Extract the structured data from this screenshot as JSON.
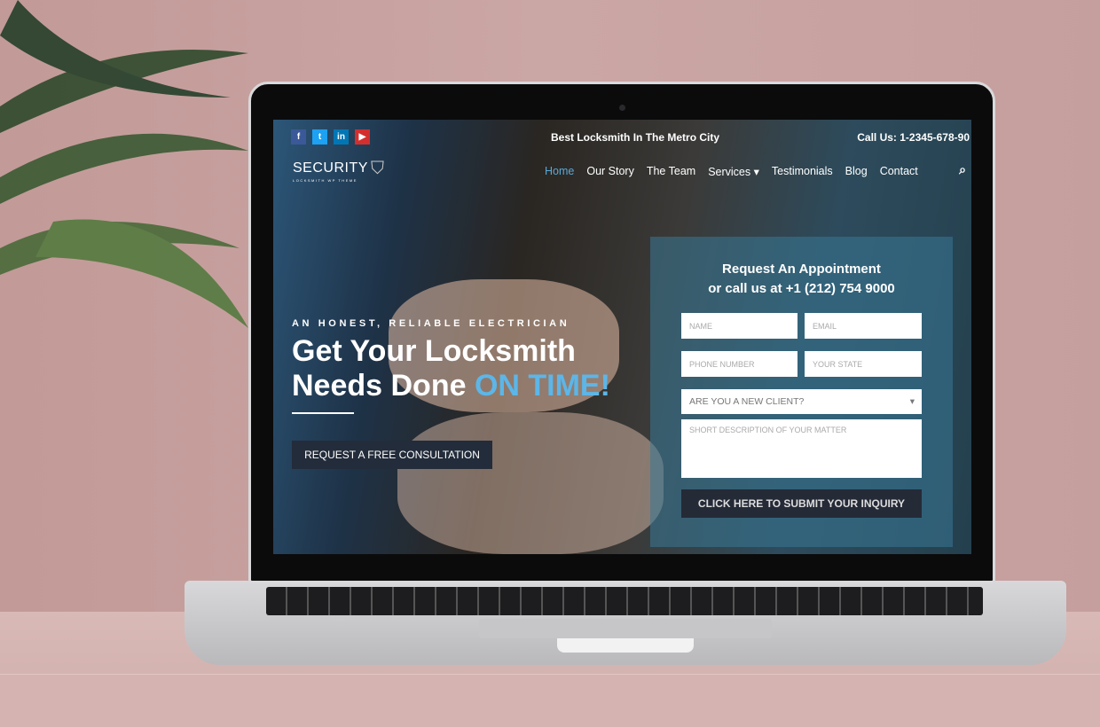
{
  "topbar": {
    "social": [
      {
        "icon": "facebook-icon",
        "label": "f",
        "color": "#3b5998"
      },
      {
        "icon": "twitter-icon",
        "label": "t",
        "color": "#1da1f2"
      },
      {
        "icon": "linkedin-icon",
        "label": "in",
        "color": "#0077b5"
      },
      {
        "icon": "youtube-icon",
        "label": "▶",
        "color": "#d32f2f"
      }
    ],
    "tagline": "Best Locksmith In The Metro City",
    "call": "Call Us: 1-2345-678-90"
  },
  "logo": {
    "main": "SECURITY",
    "sub": "LOCKSMITH WP THEME"
  },
  "nav": {
    "items": [
      "Home",
      "Our Story",
      "The Team",
      "Services ▾",
      "Testimonials",
      "Blog",
      "Contact"
    ],
    "active": "Home"
  },
  "hero": {
    "eyebrow": "AN HONEST, RELIABLE ELECTRICIAN",
    "line1": "Get Your Locksmith",
    "line2": "Needs Done ",
    "highlight": "ON TIME!",
    "cta": "REQUEST A FREE CONSULTATION"
  },
  "form": {
    "title1": "Request An Appointment",
    "title2": "or call us at +1 (212) 754 9000",
    "name": "NAME",
    "email": "EMAIL",
    "phone": "PHONE NUMBER",
    "state": "YOUR STATE",
    "client": "ARE YOU A NEW CLIENT?",
    "description": "SHORT DESCRIPTION OF YOUR MATTER",
    "submit": "CLICK HERE TO SUBMIT YOUR INQUIRY"
  }
}
